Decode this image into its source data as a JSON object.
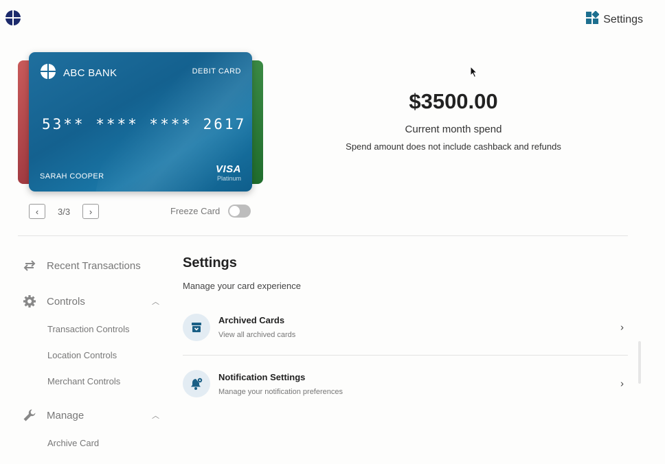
{
  "header": {
    "settings_label": "Settings"
  },
  "card": {
    "bank_name": "ABC BANK",
    "type": "DEBIT CARD",
    "number": "53** **** **** 2617",
    "holder": "SARAH COOPER",
    "brand": "VISA",
    "tier": "Platinum"
  },
  "pager": {
    "prev": "‹",
    "position": "3/3",
    "next": "›"
  },
  "freeze": {
    "label": "Freeze Card",
    "on": false
  },
  "spend": {
    "amount": "$3500.00",
    "label": "Current month spend",
    "note": "Spend amount does not include cashback and refunds"
  },
  "sidebar": {
    "recent": "Recent Transactions",
    "controls": {
      "label": "Controls",
      "items": [
        "Transaction Controls",
        "Location Controls",
        "Merchant Controls"
      ]
    },
    "manage": {
      "label": "Manage",
      "items": [
        "Archive Card"
      ]
    }
  },
  "main": {
    "title": "Settings",
    "subtitle": "Manage your card experience",
    "rows": [
      {
        "title": "Archived Cards",
        "desc": "View all archived cards",
        "icon": "archive-icon"
      },
      {
        "title": "Notification Settings",
        "desc": "Manage your notification preferences",
        "icon": "bell-gear-icon"
      }
    ]
  },
  "colors": {
    "accent": "#1a5f85",
    "card": "#14618f",
    "red_card": "#a33c42",
    "green_card": "#2a7a35"
  }
}
